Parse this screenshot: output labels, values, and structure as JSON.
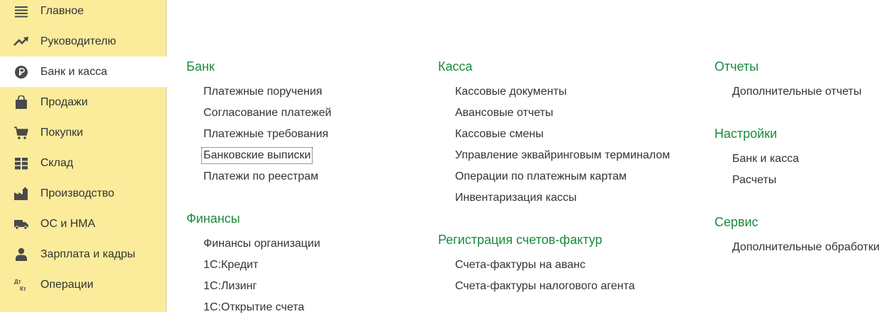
{
  "sidebar": {
    "items": [
      {
        "label": "Главное",
        "icon": "menu-icon"
      },
      {
        "label": "Руководителю",
        "icon": "trend-chart-icon"
      },
      {
        "label": "Банк и касса",
        "icon": "ruble-icon",
        "active": true
      },
      {
        "label": "Продажи",
        "icon": "shopping-bag-icon"
      },
      {
        "label": "Покупки",
        "icon": "shopping-cart-icon"
      },
      {
        "label": "Склад",
        "icon": "warehouse-grid-icon"
      },
      {
        "label": "Производство",
        "icon": "factory-icon"
      },
      {
        "label": "ОС и НМА",
        "icon": "truck-icon"
      },
      {
        "label": "Зарплата и кадры",
        "icon": "person-icon"
      },
      {
        "label": "Операции",
        "icon": "debit-credit-icon",
        "icon_text": [
          "Дт",
          "Кт"
        ]
      }
    ]
  },
  "sections": {
    "bank": {
      "title": "Банк",
      "links": [
        "Платежные поручения",
        "Согласование платежей",
        "Платежные требования",
        "Банковские выписки",
        "Платежи по реестрам"
      ]
    },
    "finance": {
      "title": "Финансы",
      "links": [
        "Финансы организации",
        "1С:Кредит",
        "1С:Лизинг",
        "1С:Открытие счета"
      ]
    },
    "kassa": {
      "title": "Касса",
      "links": [
        "Кассовые документы",
        "Авансовые отчеты",
        "Кассовые смены",
        "Управление эквайринговым терминалом",
        "Операции по платежным картам",
        "Инвентаризация кассы"
      ]
    },
    "invoices": {
      "title": "Регистрация счетов-фактур",
      "links": [
        "Счета-фактуры на аванс",
        "Счета-фактуры налогового агента"
      ]
    },
    "reports": {
      "title": "Отчеты",
      "links": [
        "Дополнительные отчеты"
      ]
    },
    "settings": {
      "title": "Настройки",
      "links": [
        "Банк и касса",
        "Расчеты"
      ]
    },
    "service": {
      "title": "Сервис",
      "links": [
        "Дополнительные обработки"
      ]
    }
  },
  "colors": {
    "sidebar_bg": "#fbec9c",
    "section_title": "#1a8a3d",
    "text": "#333333",
    "icon": "#4a4a4a"
  }
}
